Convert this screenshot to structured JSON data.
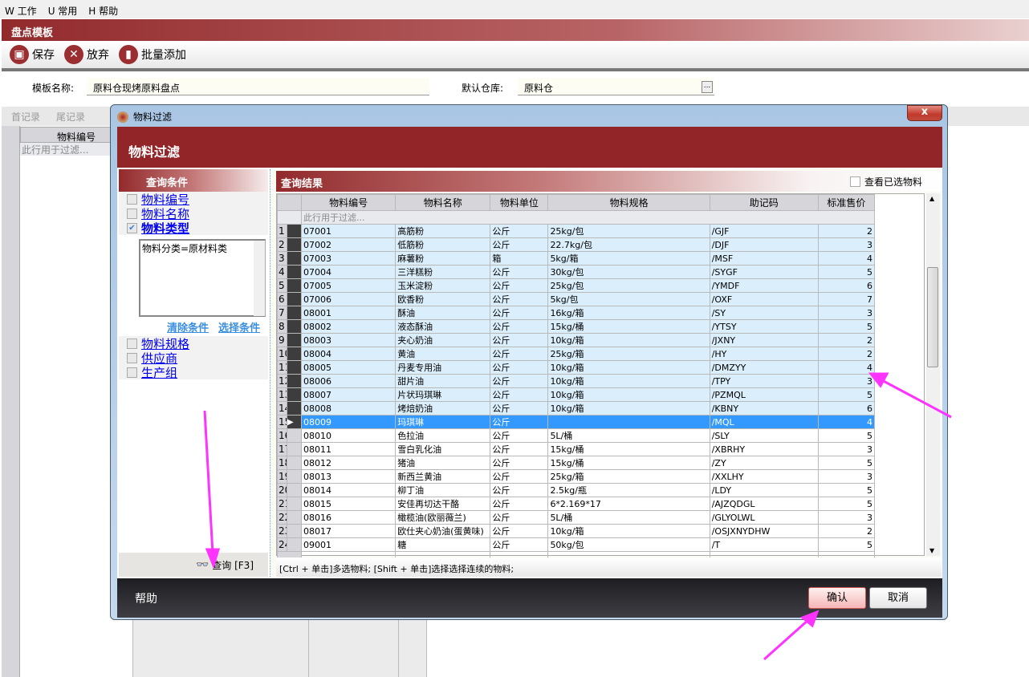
{
  "menu": [
    "W 工作",
    "U 常用",
    "H 帮助"
  ],
  "app_title": "盘点模板",
  "toolbar": {
    "save": "保存",
    "discard": "放弃",
    "batch_add": "批量添加"
  },
  "form": {
    "template_name_label": "模板名称:",
    "template_name": "原料仓现烤原料盘点",
    "warehouse_label": "默认仓库:",
    "warehouse": "原料仓",
    "browse": "..."
  },
  "nav": {
    "first": "首记录",
    "last": "尾记录"
  },
  "bg_grid": {
    "col": "物料编号",
    "filter": "此行用于过滤..."
  },
  "dialog": {
    "title": "物料过滤",
    "header": "物料过滤",
    "close": "x"
  },
  "criteria": {
    "title": "查询条件",
    "items": [
      {
        "label": "物料编号",
        "checked": false
      },
      {
        "label": "物料名称",
        "checked": false
      },
      {
        "label": "物料类型",
        "checked": true
      }
    ],
    "condition_text": "物料分类=原材料类",
    "clear": "清除条件",
    "select": "选择条件",
    "items2": [
      {
        "label": "物料规格",
        "checked": false
      },
      {
        "label": "供应商",
        "checked": false
      },
      {
        "label": "生产组",
        "checked": false
      }
    ],
    "query_button": "查询 [F3]"
  },
  "results": {
    "title": "查询结果",
    "see_selected": "查看已选物料",
    "filter_hint": "此行用于过滤...",
    "columns": [
      "物料编号",
      "物料名称",
      "物料单位",
      "物料规格",
      "助记码",
      "标准售价"
    ],
    "rows": [
      [
        "07001",
        "高筋粉",
        "公斤",
        "25kg/包",
        "/GJF",
        "2"
      ],
      [
        "07002",
        "低筋粉",
        "公斤",
        "22.7kg/包",
        "/DJF",
        "3"
      ],
      [
        "07003",
        "麻薯粉",
        "箱",
        "5kg/箱",
        "/MSF",
        "4"
      ],
      [
        "07004",
        "三洋糕粉",
        "公斤",
        "30kg/包",
        "/SYGF",
        "5"
      ],
      [
        "07005",
        "玉米淀粉",
        "公斤",
        "25kg/包",
        "/YMDF",
        "6"
      ],
      [
        "07006",
        "欧香粉",
        "公斤",
        "5kg/包",
        "/OXF",
        "7"
      ],
      [
        "08001",
        "酥油",
        "公斤",
        "16kg/箱",
        "/SY",
        "3"
      ],
      [
        "08002",
        "液态酥油",
        "公斤",
        "15kg/桶",
        "/YTSY",
        "5"
      ],
      [
        "08003",
        "夹心奶油",
        "公斤",
        "10kg/箱",
        "/JXNY",
        "2"
      ],
      [
        "08004",
        "黄油",
        "公斤",
        "25kg/箱",
        "/HY",
        "2"
      ],
      [
        "08005",
        "丹麦专用油",
        "公斤",
        "10kg/箱",
        "/DMZYY",
        "4"
      ],
      [
        "08006",
        "甜片油",
        "公斤",
        "10kg/箱",
        "/TPY",
        "3"
      ],
      [
        "08007",
        "片状玛琪琳",
        "公斤",
        "10kg/箱",
        "/PZMQL",
        "5"
      ],
      [
        "08008",
        "烤焙奶油",
        "公斤",
        "10kg/箱",
        "/KBNY",
        "6"
      ],
      [
        "08009",
        "玛琪琳",
        "公斤",
        "",
        "/MQL",
        "4"
      ],
      [
        "08010",
        "色拉油",
        "公斤",
        "5L/桶",
        "/SLY",
        "5"
      ],
      [
        "08011",
        "雪白乳化油",
        "公斤",
        "15kg/桶",
        "/XBRHY",
        "3"
      ],
      [
        "08012",
        "猪油",
        "公斤",
        "15kg/桶",
        "/ZY",
        "5"
      ],
      [
        "08013",
        "新西兰黄油",
        "公斤",
        "25kg/箱",
        "/XXLHY",
        "3"
      ],
      [
        "08014",
        "柳丁油",
        "公斤",
        "2.5kg/瓶",
        "/LDY",
        "5"
      ],
      [
        "08015",
        "安佳再切达干酪",
        "公斤",
        "6*2.169*17",
        "/AJZQDGL",
        "5"
      ],
      [
        "08016",
        "橄榄油(欧丽薇兰)",
        "公斤",
        "5L/桶",
        "/GLYOLWL",
        "3"
      ],
      [
        "08017",
        "欧仕夹心奶油(蛋黄味)",
        "公斤",
        "10kg/箱",
        "/OSJXNYDHW",
        "2"
      ],
      [
        "09001",
        "糖",
        "公斤",
        "50kg/包",
        "/T",
        "5"
      ]
    ],
    "selected_rows": 14,
    "current_row": 15,
    "status": "[Ctrl + 单击]多选物料; [Shift + 单击]选择选择连续的物料;"
  },
  "footer": {
    "help": "帮助",
    "ok": "确认",
    "cancel": "取消"
  },
  "colors": {
    "brand": "#922528",
    "selection": "#dbeefb",
    "current": "#3399ff",
    "annotation": "#ff33ff"
  }
}
